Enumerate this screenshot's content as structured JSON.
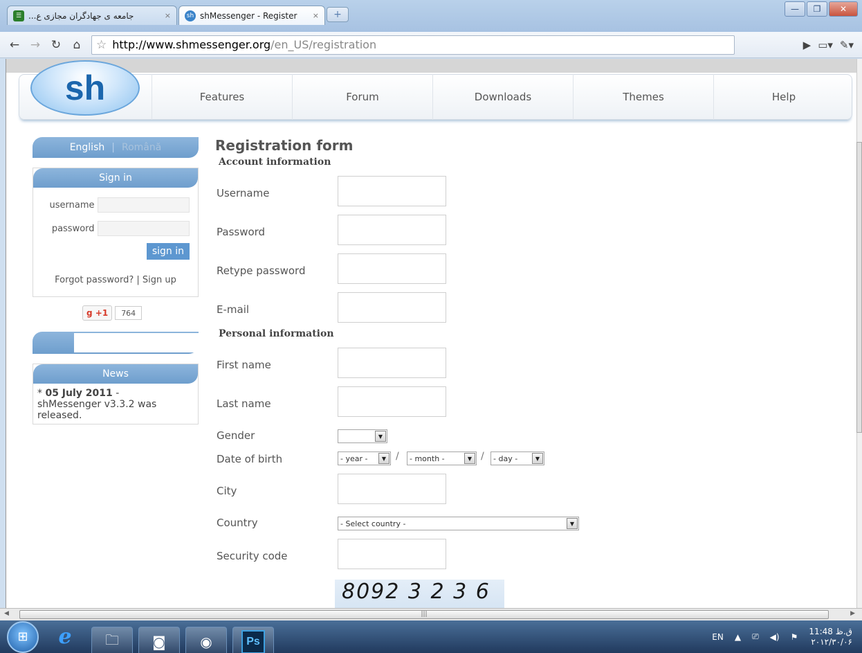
{
  "browser": {
    "tabs": [
      {
        "label": "...جامعه ی جهادگران مجازی ع",
        "close": "×"
      },
      {
        "label": "shMessenger - Register",
        "close": "×"
      }
    ],
    "new_tab": "+",
    "url_host": "http://www.shmessenger.org",
    "url_path": "/en_US/registration"
  },
  "header": {
    "logo": "sh",
    "nav": [
      "Features",
      "Forum",
      "Downloads",
      "Themes",
      "Help"
    ]
  },
  "sidebar": {
    "lang_en": "English",
    "lang_sep": "|",
    "lang_ro": "Română",
    "signin_title": "Sign in",
    "username_label": "username",
    "password_label": "password",
    "signin_button": "sign in",
    "forgot_link": "Forgot password?",
    "links_sep": " | ",
    "signup_link": "Sign up",
    "gplus_label": "+1",
    "gplus_count": "764",
    "news_title": "News",
    "news_date": "05 July 2011",
    "news_text": "shMessenger v3.3.2 was released."
  },
  "form": {
    "title": "Registration form",
    "account_section": "Account information",
    "personal_section": "Personal information",
    "fields": {
      "username": "Username",
      "password": "Password",
      "retype": "Retype password",
      "email": "E-mail",
      "first_name": "First name",
      "last_name": "Last name",
      "gender": "Gender",
      "dob": "Date of birth",
      "city": "City",
      "country": "Country",
      "security": "Security code"
    },
    "year": "- year -",
    "month": "- month -",
    "day": "- day -",
    "country_select": "- Select country -",
    "captcha": "8092 3 2 3 6"
  },
  "taskbar": {
    "ps": "Ps",
    "lang": "EN",
    "time": "11:48 ق.ظ",
    "date": "۲۰۱۲/۳۰/۰۶"
  }
}
